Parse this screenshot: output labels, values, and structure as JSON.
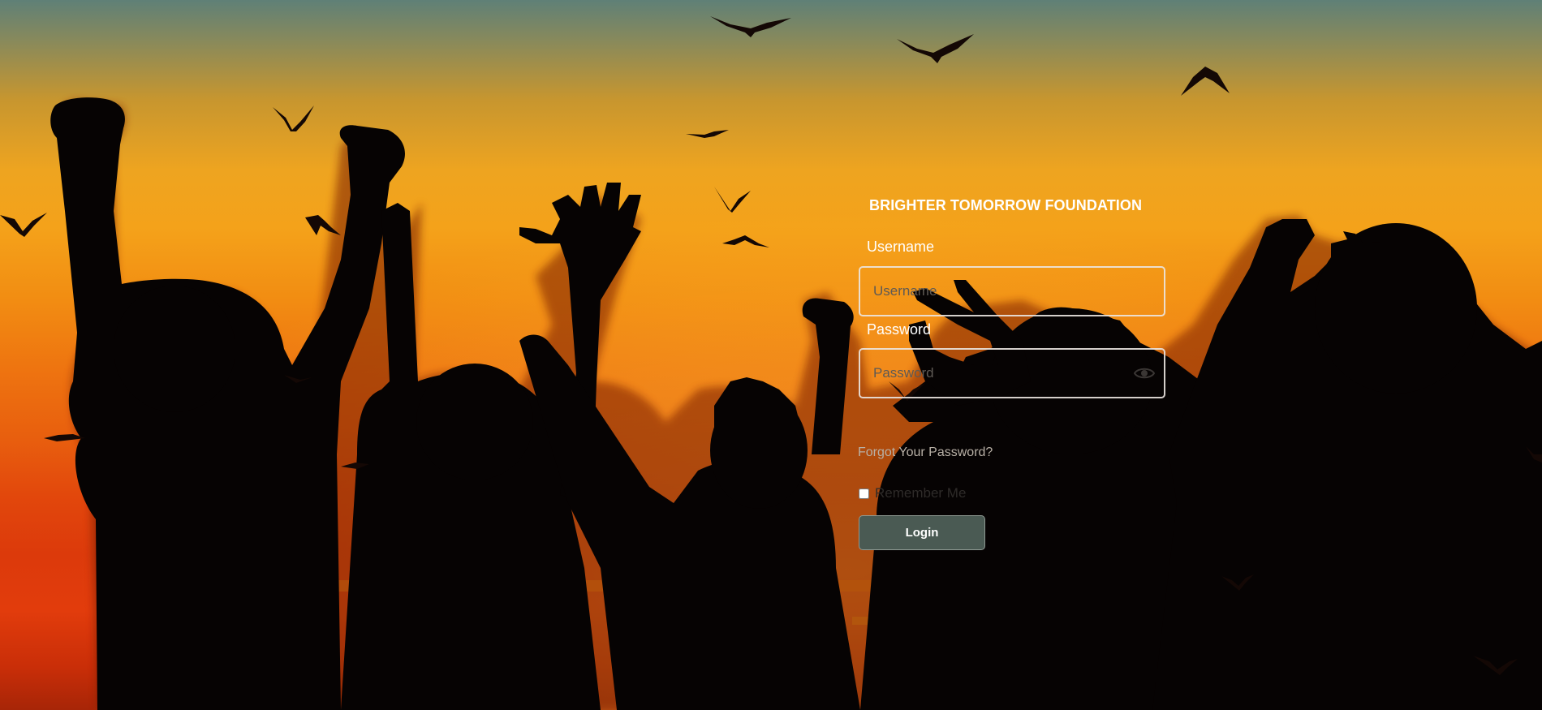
{
  "background": {
    "image": "sunset-silhouette-children-birds"
  },
  "login": {
    "org_title": "BRIGHTER TOMORROW FOUNDATION",
    "username_label": "Username",
    "username_placeholder": "Username",
    "username_value": "",
    "password_label": "Password",
    "password_placeholder": "Password",
    "password_value": "",
    "password_toggle_icon": "eye-icon",
    "forgot_password_link": "Forgot Your Password?",
    "remember_me_label": "Remember Me",
    "remember_me_checked": false,
    "login_button_label": "Login"
  },
  "colors": {
    "panel_text": "#ffffff",
    "login_button_bg": "#4a5a53",
    "field_border": "#ebe6e1",
    "link_text": "#b8b0a6"
  }
}
